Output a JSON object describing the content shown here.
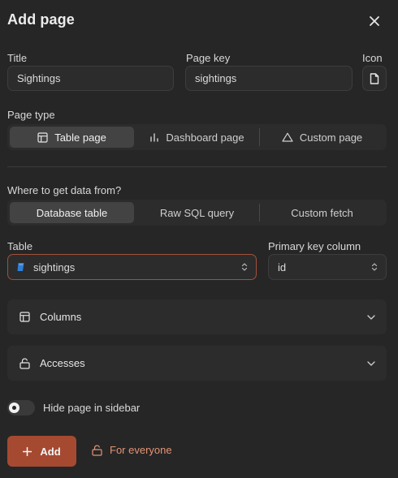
{
  "dialog": {
    "title": "Add page",
    "close_icon": "close-icon"
  },
  "fields": {
    "title_label": "Title",
    "title_value": "Sightings",
    "page_key_label": "Page key",
    "page_key_value": "sightings",
    "icon_label": "Icon",
    "icon_name": "file-icon"
  },
  "page_type": {
    "label": "Page type",
    "options": [
      {
        "label": "Table page",
        "icon": "table-icon",
        "active": true
      },
      {
        "label": "Dashboard page",
        "icon": "bar-chart-icon",
        "active": false
      },
      {
        "label": "Custom page",
        "icon": "triangle-icon",
        "active": false
      }
    ]
  },
  "data_source": {
    "label": "Where to get data from?",
    "options": [
      {
        "label": "Database table",
        "active": true
      },
      {
        "label": "Raw SQL query",
        "active": false
      },
      {
        "label": "Custom fetch",
        "active": false
      }
    ]
  },
  "table_select": {
    "label": "Table",
    "value": "sightings",
    "icon": "database-table-icon"
  },
  "primary_key": {
    "label": "Primary key column",
    "value": "id"
  },
  "sections": {
    "columns": "Columns",
    "accesses": "Accesses"
  },
  "sidebar_toggle": {
    "label": "Hide page in sidebar",
    "on": false
  },
  "footer": {
    "add_label": "Add",
    "access_label": "For everyone"
  },
  "colors": {
    "background": "#262626",
    "accent": "#a54a31",
    "accent_text": "#e49476",
    "focus_border": "#a2503a"
  }
}
